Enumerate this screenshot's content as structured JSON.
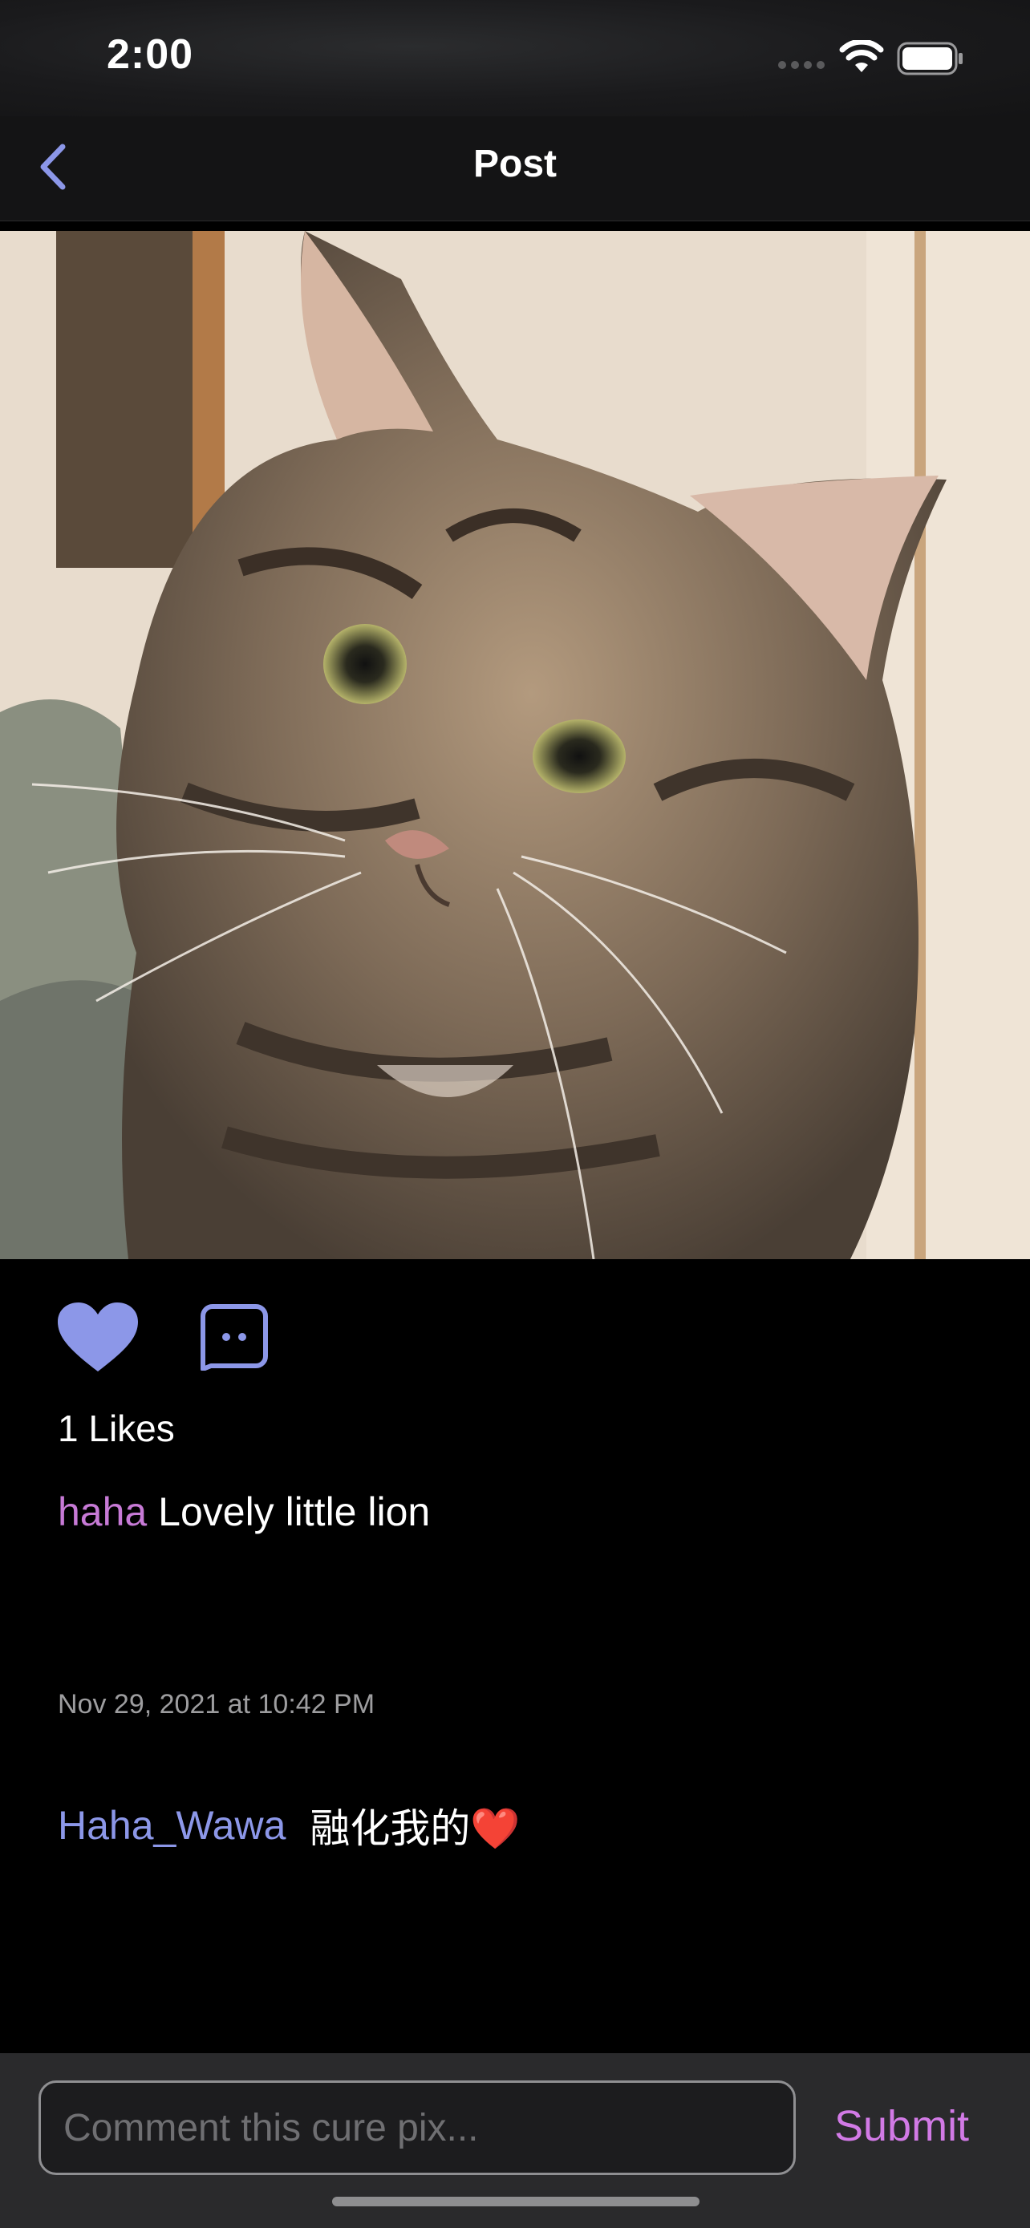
{
  "status_bar": {
    "time": "2:00",
    "icons": [
      "cellular-signal-icon",
      "wifi-icon",
      "battery-icon"
    ]
  },
  "nav": {
    "title": "Post",
    "back_icon": "chevron-left-icon"
  },
  "post": {
    "image_subject": "tabby cat portrait",
    "actions": {
      "like_icon": "heart-icon",
      "comment_icon": "comment-bubble-icon"
    },
    "likes_text": "1 Likes",
    "caption_user": "haha",
    "caption_text": "Lovely little lion",
    "timestamp": "Nov 29, 2021 at 10:42 PM"
  },
  "comments": [
    {
      "user": "Haha_Wawa",
      "text": "融化我的❤️"
    }
  ],
  "composer": {
    "placeholder": "Comment this cure pix...",
    "submit_label": "Submit"
  },
  "colors": {
    "accent": "#8c97e8",
    "caption_user": "#c77ad6",
    "submit": "#d27ae6",
    "background": "#000000"
  }
}
